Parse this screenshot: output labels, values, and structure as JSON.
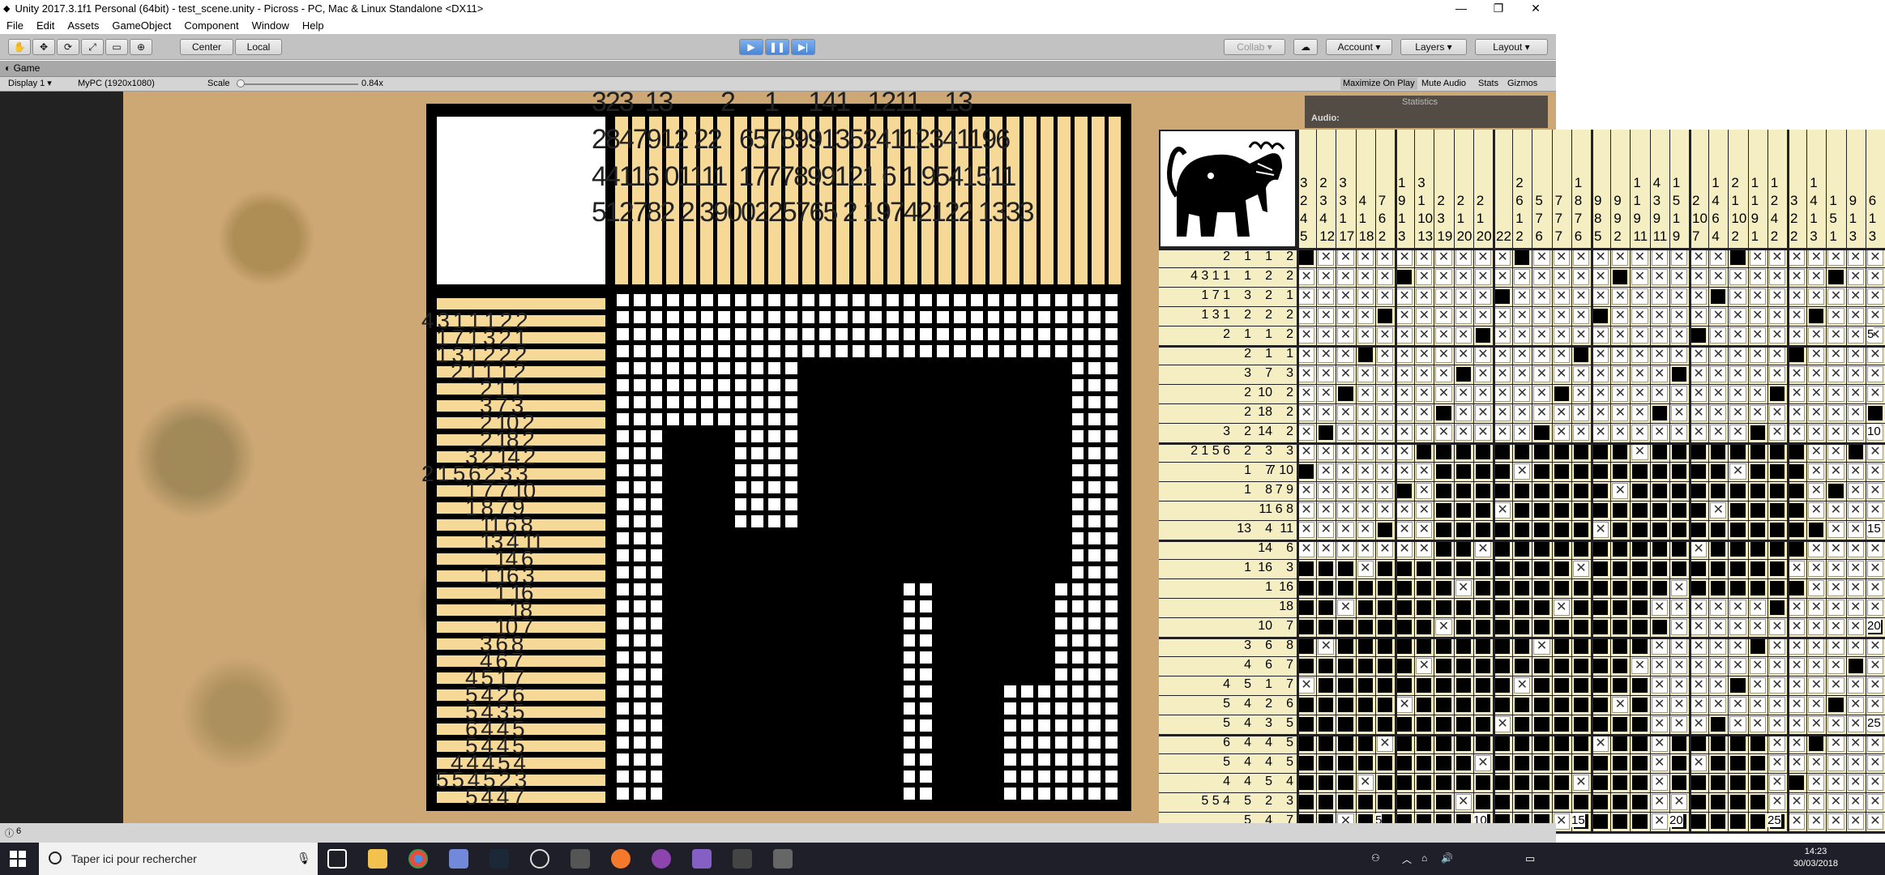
{
  "window": {
    "title": "Unity 2017.3.1f1 Personal (64bit) - test_scene.unity - Picross - PC, Mac & Linux Standalone <DX11>",
    "minimize": "—",
    "maximize": "❐",
    "close": "✕"
  },
  "menu": [
    "File",
    "Edit",
    "Assets",
    "GameObject",
    "Component",
    "Window",
    "Help"
  ],
  "toolbar": {
    "center": "Center",
    "local": "Local",
    "collab": "Collab ▾",
    "account": "Account",
    "layers": "Layers",
    "layout": "Layout"
  },
  "game": {
    "tab": "Game",
    "display": "Display 1",
    "resolution": "MyPC (1920x1080)",
    "scale_label": "Scale",
    "scale_value": "0.84x",
    "maximize": "Maximize On Play",
    "mute": "Mute Audio",
    "stats": "Stats",
    "gizmos": "Gizmos",
    "stats_panel_title": "Statistics",
    "stats_panel_audio": "Audio:"
  },
  "status": {
    "count": "6"
  },
  "taskbar": {
    "search_placeholder": "Taper ici pour rechercher",
    "time": "14:23",
    "date": "30/03/2018"
  },
  "board": {
    "col_clue_rows": [
      "323  13        2     1     141   1211    13",
      "2847912 22   65789913524112341196",
      "44116 01111  1777899121 6 1 9541511",
      "512782 2 3900225765 2 19742122 1333"
    ],
    "row_clue_text": [
      "4 3 1 1 1 2 2",
      "1 7 1 3 2 1",
      "1 3 1 2 2 2",
      "2 1 1 1 2",
      "2 1 1",
      "3 7 3",
      "2 10 2",
      "2 18 2",
      "3 2 14 2",
      "2 1 5 6 2 3 3",
      "1 7 7 10",
      "1 8 7 9",
      "11 6 8",
      "13 4 11",
      "14 6",
      "1 16 3",
      "1 16",
      "18",
      "10 7",
      "3 6 8",
      "4 6 7",
      "4 5 1 7",
      "5 4 2 6",
      "5 4 3 5",
      "6 4 4 5",
      "5 4 4 5",
      "4 4 4 5 4",
      "5 5 4 5 2 3",
      "5 4 4 7"
    ]
  },
  "right_panel": {
    "col_clues_row1": [
      "",
      "",
      "",
      "",
      "",
      "",
      "",
      "",
      "",
      "",
      "",
      "",
      "",
      "",
      "",
      "",
      "",
      "",
      "",
      "",
      "",
      "",
      "",
      "",
      "",
      "",
      "",
      "",
      "",
      "",
      "",
      "",
      "1",
      ""
    ],
    "col_clues": [
      [
        "3",
        "2",
        "4",
        "5"
      ],
      [
        "2",
        "3",
        "4",
        "12"
      ],
      [
        "3",
        "3",
        "1",
        "17"
      ],
      [
        "",
        "4",
        "1",
        "18"
      ],
      [
        "",
        "7",
        "6",
        "2"
      ],
      [
        "1",
        "9",
        "1",
        "3"
      ],
      [
        "3",
        "1",
        "10",
        "13"
      ],
      [
        "",
        "2",
        "3",
        "19"
      ],
      [
        "",
        "2",
        "1",
        "20"
      ],
      [
        "",
        "2",
        "1",
        "20"
      ],
      [
        "",
        "",
        "",
        "22"
      ],
      [
        "2",
        "6",
        "1",
        "2"
      ],
      [
        "",
        "5",
        "7",
        "6"
      ],
      [
        "",
        "7",
        "7",
        "7"
      ],
      [
        "1",
        "8",
        "7",
        "6"
      ],
      [
        "",
        "9",
        "8",
        "5"
      ],
      [
        "",
        "9",
        "9",
        "2"
      ],
      [
        "1",
        "1",
        "9",
        "11"
      ],
      [
        "4",
        "3",
        "9",
        "11"
      ],
      [
        "1",
        "5",
        "1",
        "9"
      ],
      [
        "",
        "2",
        "10",
        "7"
      ],
      [
        "1",
        "4",
        "6",
        "4"
      ],
      [
        "2",
        "1",
        "10",
        "2"
      ],
      [
        "1",
        "1",
        "9",
        "1"
      ],
      [
        "1",
        "2",
        "4",
        "2"
      ],
      [
        "",
        "3",
        "2",
        "2"
      ],
      [
        "1",
        "4",
        "1",
        "3"
      ],
      [
        "",
        "1",
        "5",
        "1"
      ],
      [
        "",
        "9",
        "1",
        "3"
      ],
      [
        "",
        "6",
        "1",
        "3"
      ],
      [
        "",
        "",
        "",
        ""
      ],
      [
        "",
        "",
        "",
        ""
      ]
    ],
    "row_clues": [
      [
        "2",
        "1",
        "1",
        "2"
      ],
      [
        "4 3 1 1",
        "1",
        "2",
        "2"
      ],
      [
        "1 7 1",
        "3",
        "2",
        "1"
      ],
      [
        "1 3 1",
        "2",
        "2",
        "2"
      ],
      [
        "2",
        "1",
        "1",
        "2"
      ],
      [
        "",
        "2",
        "1",
        "1"
      ],
      [
        "",
        "3",
        "7",
        "3"
      ],
      [
        "",
        "2",
        "10",
        "2"
      ],
      [
        "",
        "2",
        "18",
        "2"
      ],
      [
        "3",
        "2",
        "14",
        "2"
      ],
      [
        "2 1 5 6",
        "2",
        "3",
        "3"
      ],
      [
        "",
        "1",
        "7",
        "7 10"
      ],
      [
        "",
        "1",
        "8",
        "7 9"
      ],
      [
        "",
        "",
        "11",
        "6 8"
      ],
      [
        "",
        "13",
        "4",
        "11"
      ],
      [
        "",
        "",
        "14",
        "6"
      ],
      [
        "",
        "1",
        "16",
        "3"
      ],
      [
        "",
        "",
        "1",
        "16"
      ],
      [
        "",
        "",
        "",
        "18"
      ],
      [
        "",
        "",
        "10",
        "7"
      ],
      [
        "",
        "3",
        "6",
        "8"
      ],
      [
        "",
        "4",
        "6",
        "7"
      ],
      [
        "4",
        "5",
        "1",
        "7"
      ],
      [
        "5",
        "4",
        "2",
        "6"
      ],
      [
        "5",
        "4",
        "3",
        "5"
      ],
      [
        "6",
        "4",
        "4",
        "5"
      ],
      [
        "5",
        "4",
        "4",
        "5"
      ],
      [
        "4",
        "4",
        "5",
        "4"
      ],
      [
        "5 5 4",
        "5",
        "2",
        "3"
      ],
      [
        "",
        "5",
        "4",
        "7"
      ]
    ],
    "axis_marks_bottom": [
      "5",
      "10",
      "15",
      "20",
      "25"
    ],
    "axis_marks_right": [
      "5",
      "10",
      "15",
      "20",
      "25"
    ]
  }
}
